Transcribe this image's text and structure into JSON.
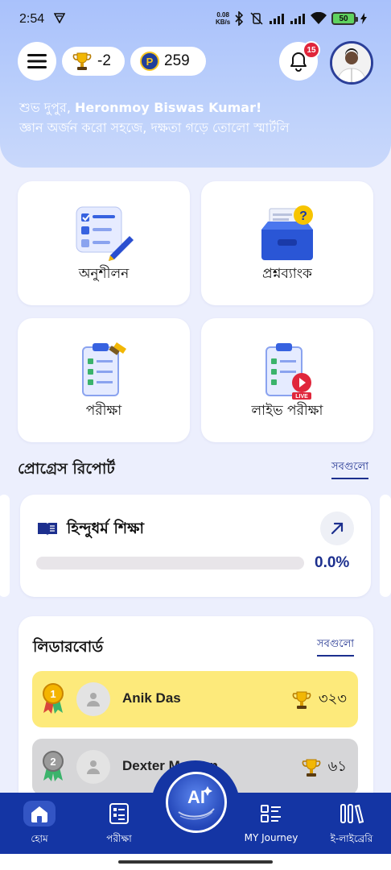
{
  "status_bar": {
    "time": "2:54",
    "net_speed_value": "0.08",
    "net_speed_unit": "KB/s",
    "battery": "50"
  },
  "header": {
    "trophy_points": "-2",
    "coin_symbol": "P",
    "coins": "259",
    "notification_count": "15"
  },
  "greeting": {
    "salutation": "শুভ দুপুর, ",
    "user_name": "Heronmoy Biswas Kumar!",
    "tagline": "জ্ঞান অর্জন করো সহজে, দক্ষতা গড়ে তোলো স্মার্টলি"
  },
  "tiles": {
    "practice": "অনুশীলন",
    "question_bank": "প্রশ্নব্যাংক",
    "exam": "পরীক্ষা",
    "live_exam": "লাইভ পরীক্ষা",
    "live_tag": "LIVE"
  },
  "progress": {
    "section_title": "প্রোগ্রেস রিপোর্ট",
    "see_all": "সবগুলো",
    "subject": "হিন্দুধর্ম শিক্ষা",
    "percent_label": "0.0%",
    "fraction": 0.0
  },
  "leaderboard": {
    "section_title": "লিডারবোর্ড",
    "see_all": "সবগুলো",
    "rows": [
      {
        "rank": "1",
        "name": "Anik Das",
        "score": "৩২৩",
        "bg": "#fdea7b"
      },
      {
        "rank": "2",
        "name": "Dexter Morgan",
        "score": "৬১",
        "bg": "#d6d6d8"
      }
    ]
  },
  "bottom_nav": {
    "home": "হোম",
    "exam": "পরীক্ষা",
    "ai_label": "AI",
    "journey": "MY Journey",
    "library": "ই-লাইব্রেরি"
  },
  "colors": {
    "primary": "#1c2f8e",
    "nav": "#1435a4",
    "badge": "#e0263b",
    "gold_row": "#fdea7b",
    "silver_row": "#d6d6d8"
  }
}
